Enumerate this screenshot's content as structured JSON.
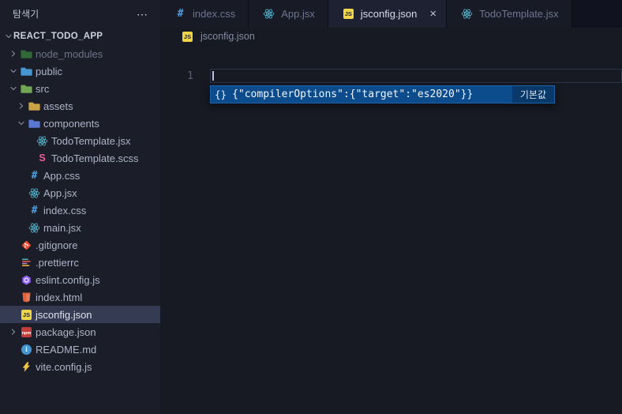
{
  "sidebar": {
    "title": "탐색기",
    "actions_label": "⋯",
    "project": "REACT_TODO_APP",
    "tree": [
      {
        "label": "node_modules",
        "icon": "folder-node_modules",
        "level": 0,
        "chevron": "collapsed",
        "dimmed": true
      },
      {
        "label": "public",
        "icon": "folder-public",
        "level": 0,
        "chevron": "expanded"
      },
      {
        "label": "src",
        "icon": "folder-src",
        "level": 0,
        "chevron": "expanded"
      },
      {
        "label": "assets",
        "icon": "folder-assets",
        "level": 1,
        "chevron": "collapsed"
      },
      {
        "label": "components",
        "icon": "folder-components",
        "level": 1,
        "chevron": "expanded"
      },
      {
        "label": "TodoTemplate.jsx",
        "icon": "react",
        "level": 2
      },
      {
        "label": "TodoTemplate.scss",
        "icon": "sass",
        "level": 2
      },
      {
        "label": "App.css",
        "icon": "css",
        "level": 1
      },
      {
        "label": "App.jsx",
        "icon": "react",
        "level": 1
      },
      {
        "label": "index.css",
        "icon": "css",
        "level": 1
      },
      {
        "label": "main.jsx",
        "icon": "react",
        "level": 1
      },
      {
        "label": ".gitignore",
        "icon": "git",
        "level": 0
      },
      {
        "label": ".prettierrc",
        "icon": "prettier",
        "level": 0
      },
      {
        "label": "eslint.config.js",
        "icon": "eslint",
        "level": 0
      },
      {
        "label": "index.html",
        "icon": "html",
        "level": 0
      },
      {
        "label": "jsconfig.json",
        "icon": "jsbadge",
        "level": 0,
        "selected": true
      },
      {
        "label": "package.json",
        "icon": "npm",
        "level": 0,
        "chevron": "collapsed"
      },
      {
        "label": "README.md",
        "icon": "readme",
        "level": 0
      },
      {
        "label": "vite.config.js",
        "icon": "vite",
        "level": 0
      }
    ]
  },
  "tabs": {
    "close_glyph": "×",
    "items": [
      {
        "label": "index.css",
        "icon": "css",
        "active": false
      },
      {
        "label": "App.jsx",
        "icon": "react",
        "active": false
      },
      {
        "label": "jsconfig.json",
        "icon": "jsbadge",
        "active": true
      },
      {
        "label": "TodoTemplate.jsx",
        "icon": "react",
        "active": false
      }
    ]
  },
  "breadcrumb": {
    "file": "jsconfig.json"
  },
  "editor": {
    "line_number": "1",
    "suggestion": {
      "icon": "{}",
      "text": "{\"compilerOptions\":{\"target\":\"es2020\"}}",
      "detail": "기본값"
    }
  },
  "colors": {
    "suggest_selected_bg": "#0c4c8c",
    "sidebar_bg": "#1b1d29",
    "editor_bg": "#171923",
    "selection_row_bg": "#353b52"
  },
  "icon_colors": {
    "react": "#58c4dc",
    "sass": "#ef5b9c",
    "css": "#4f9fe0",
    "git": "#e84e31",
    "eslint": "#8d63f2",
    "html": "#e0613a",
    "js_badge_bg": "#efd547",
    "js_badge_fg": "#22263a",
    "npm_bg": "#c23c39",
    "readme": "#4596d1",
    "vite": "#f2c744",
    "chevron": "#8d93a8",
    "folders": {
      "node_modules": "#37833b",
      "public": "#4596d1",
      "src": "#71a653",
      "assets": "#c9a246",
      "components": "#5a77d1"
    },
    "prettier": [
      "#56b3b4",
      "#ea5e5e",
      "#bf85bf",
      "#f7ba3e"
    ]
  }
}
